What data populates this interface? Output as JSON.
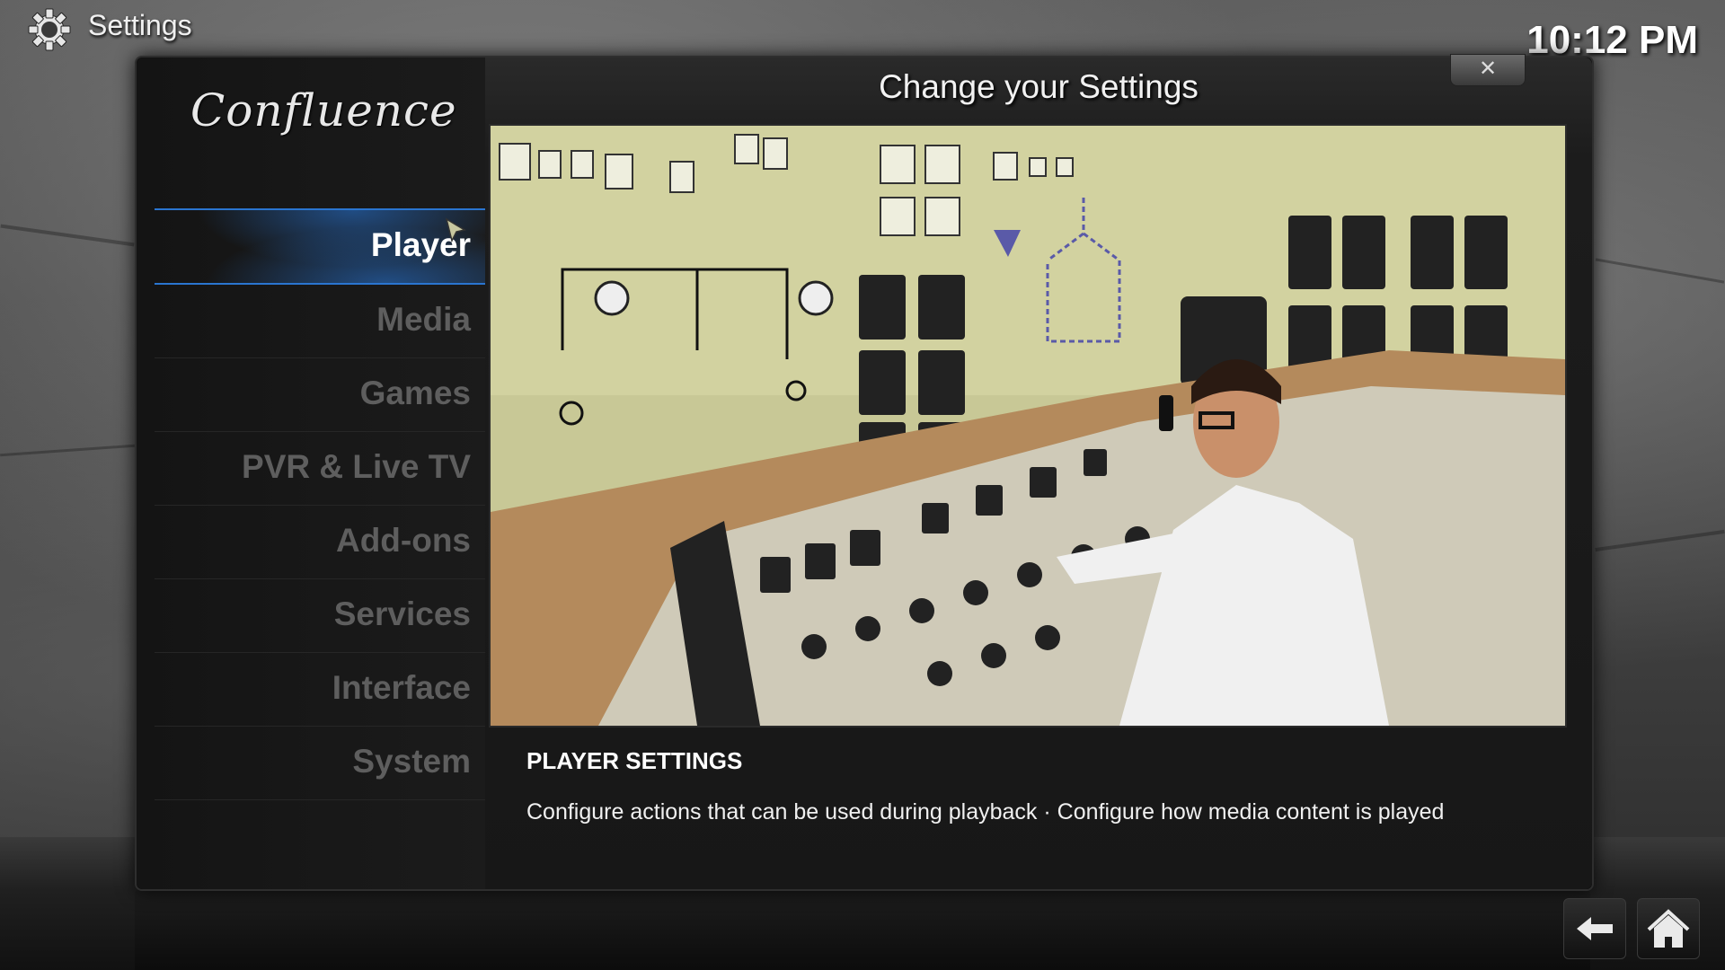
{
  "header": {
    "title": "Settings",
    "icon": "gear-icon",
    "clock": "10:12 PM"
  },
  "dialog": {
    "title": "Change your Settings",
    "close_label": "✕",
    "logo_text": "Confluence"
  },
  "menu": {
    "active_index": 0,
    "items": [
      {
        "label": "Player"
      },
      {
        "label": "Media"
      },
      {
        "label": "Games"
      },
      {
        "label": "PVR & Live TV"
      },
      {
        "label": "Add-ons"
      },
      {
        "label": "Services"
      },
      {
        "label": "Interface"
      },
      {
        "label": "System"
      }
    ]
  },
  "description": {
    "title": "PLAYER SETTINGS",
    "text": "Configure actions that can be used during playback · Configure how media content is played"
  },
  "footer": {
    "back_icon": "back-arrow-icon",
    "home_icon": "home-icon"
  },
  "colors": {
    "accent": "#2a75d0",
    "active_text": "#ffffff",
    "inactive_text": "#5e5e5e"
  }
}
